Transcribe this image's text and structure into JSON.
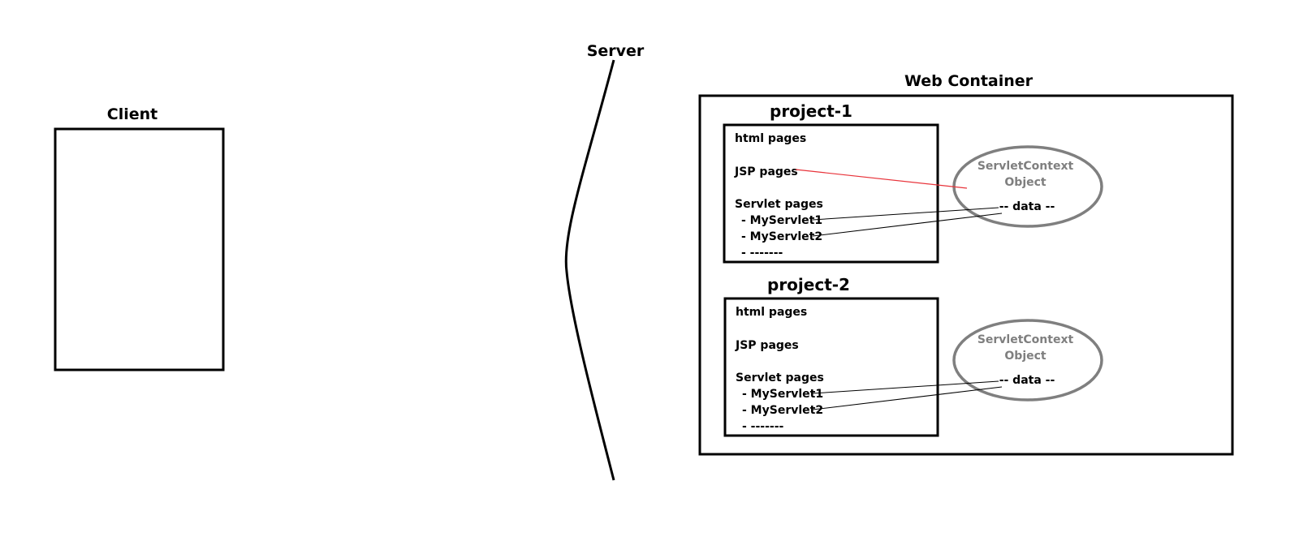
{
  "client": {
    "label": "Client"
  },
  "server": {
    "label": "Server"
  },
  "web_container": {
    "label": "Web Container"
  },
  "projects": [
    {
      "name": "project-1",
      "items": {
        "html": "html pages",
        "jsp": "JSP pages",
        "servlet_header": "Servlet pages",
        "servlet1": "- MyServlet1",
        "servlet2": "- MyServlet2",
        "more": "- -------"
      },
      "context": {
        "line1": "ServletContext",
        "line2": "Object",
        "data": "-- data --"
      }
    },
    {
      "name": "project-2",
      "items": {
        "html": "html pages",
        "jsp": "JSP pages",
        "servlet_header": "Servlet pages",
        "servlet1": "- MyServlet1",
        "servlet2": "- MyServlet2",
        "more": "- -------"
      },
      "context": {
        "line1": "ServletContext",
        "line2": "Object",
        "data": "-- data --"
      }
    }
  ],
  "colors": {
    "stroke": "#000000",
    "ellipse": "#7f7f7f",
    "context_text": "#7f7f7f",
    "jsp_link": "#e8333a"
  }
}
